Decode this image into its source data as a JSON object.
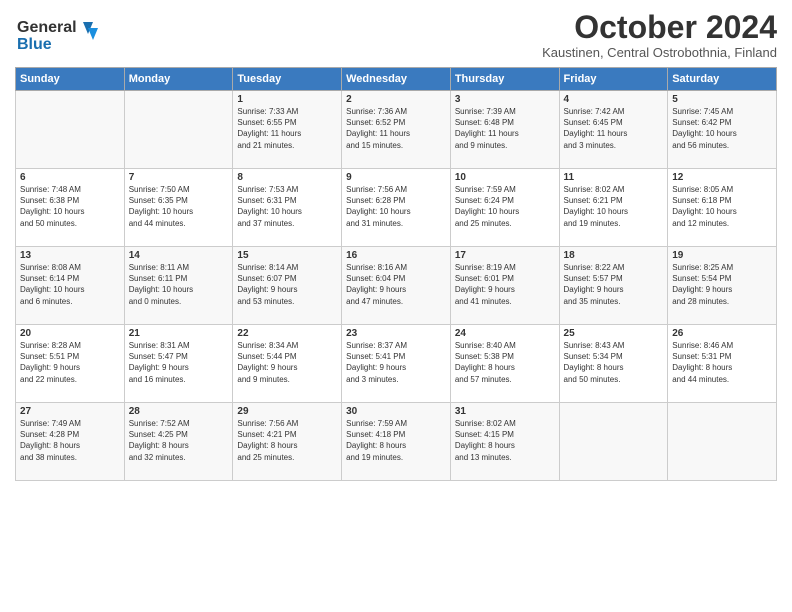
{
  "header": {
    "logo_line1": "General",
    "logo_line2": "Blue",
    "month": "October 2024",
    "location": "Kaustinen, Central Ostrobothnia, Finland"
  },
  "days_of_week": [
    "Sunday",
    "Monday",
    "Tuesday",
    "Wednesday",
    "Thursday",
    "Friday",
    "Saturday"
  ],
  "weeks": [
    [
      {
        "day": "",
        "info": ""
      },
      {
        "day": "",
        "info": ""
      },
      {
        "day": "1",
        "info": "Sunrise: 7:33 AM\nSunset: 6:55 PM\nDaylight: 11 hours\nand 21 minutes."
      },
      {
        "day": "2",
        "info": "Sunrise: 7:36 AM\nSunset: 6:52 PM\nDaylight: 11 hours\nand 15 minutes."
      },
      {
        "day": "3",
        "info": "Sunrise: 7:39 AM\nSunset: 6:48 PM\nDaylight: 11 hours\nand 9 minutes."
      },
      {
        "day": "4",
        "info": "Sunrise: 7:42 AM\nSunset: 6:45 PM\nDaylight: 11 hours\nand 3 minutes."
      },
      {
        "day": "5",
        "info": "Sunrise: 7:45 AM\nSunset: 6:42 PM\nDaylight: 10 hours\nand 56 minutes."
      }
    ],
    [
      {
        "day": "6",
        "info": "Sunrise: 7:48 AM\nSunset: 6:38 PM\nDaylight: 10 hours\nand 50 minutes."
      },
      {
        "day": "7",
        "info": "Sunrise: 7:50 AM\nSunset: 6:35 PM\nDaylight: 10 hours\nand 44 minutes."
      },
      {
        "day": "8",
        "info": "Sunrise: 7:53 AM\nSunset: 6:31 PM\nDaylight: 10 hours\nand 37 minutes."
      },
      {
        "day": "9",
        "info": "Sunrise: 7:56 AM\nSunset: 6:28 PM\nDaylight: 10 hours\nand 31 minutes."
      },
      {
        "day": "10",
        "info": "Sunrise: 7:59 AM\nSunset: 6:24 PM\nDaylight: 10 hours\nand 25 minutes."
      },
      {
        "day": "11",
        "info": "Sunrise: 8:02 AM\nSunset: 6:21 PM\nDaylight: 10 hours\nand 19 minutes."
      },
      {
        "day": "12",
        "info": "Sunrise: 8:05 AM\nSunset: 6:18 PM\nDaylight: 10 hours\nand 12 minutes."
      }
    ],
    [
      {
        "day": "13",
        "info": "Sunrise: 8:08 AM\nSunset: 6:14 PM\nDaylight: 10 hours\nand 6 minutes."
      },
      {
        "day": "14",
        "info": "Sunrise: 8:11 AM\nSunset: 6:11 PM\nDaylight: 10 hours\nand 0 minutes."
      },
      {
        "day": "15",
        "info": "Sunrise: 8:14 AM\nSunset: 6:07 PM\nDaylight: 9 hours\nand 53 minutes."
      },
      {
        "day": "16",
        "info": "Sunrise: 8:16 AM\nSunset: 6:04 PM\nDaylight: 9 hours\nand 47 minutes."
      },
      {
        "day": "17",
        "info": "Sunrise: 8:19 AM\nSunset: 6:01 PM\nDaylight: 9 hours\nand 41 minutes."
      },
      {
        "day": "18",
        "info": "Sunrise: 8:22 AM\nSunset: 5:57 PM\nDaylight: 9 hours\nand 35 minutes."
      },
      {
        "day": "19",
        "info": "Sunrise: 8:25 AM\nSunset: 5:54 PM\nDaylight: 9 hours\nand 28 minutes."
      }
    ],
    [
      {
        "day": "20",
        "info": "Sunrise: 8:28 AM\nSunset: 5:51 PM\nDaylight: 9 hours\nand 22 minutes."
      },
      {
        "day": "21",
        "info": "Sunrise: 8:31 AM\nSunset: 5:47 PM\nDaylight: 9 hours\nand 16 minutes."
      },
      {
        "day": "22",
        "info": "Sunrise: 8:34 AM\nSunset: 5:44 PM\nDaylight: 9 hours\nand 9 minutes."
      },
      {
        "day": "23",
        "info": "Sunrise: 8:37 AM\nSunset: 5:41 PM\nDaylight: 9 hours\nand 3 minutes."
      },
      {
        "day": "24",
        "info": "Sunrise: 8:40 AM\nSunset: 5:38 PM\nDaylight: 8 hours\nand 57 minutes."
      },
      {
        "day": "25",
        "info": "Sunrise: 8:43 AM\nSunset: 5:34 PM\nDaylight: 8 hours\nand 50 minutes."
      },
      {
        "day": "26",
        "info": "Sunrise: 8:46 AM\nSunset: 5:31 PM\nDaylight: 8 hours\nand 44 minutes."
      }
    ],
    [
      {
        "day": "27",
        "info": "Sunrise: 7:49 AM\nSunset: 4:28 PM\nDaylight: 8 hours\nand 38 minutes."
      },
      {
        "day": "28",
        "info": "Sunrise: 7:52 AM\nSunset: 4:25 PM\nDaylight: 8 hours\nand 32 minutes."
      },
      {
        "day": "29",
        "info": "Sunrise: 7:56 AM\nSunset: 4:21 PM\nDaylight: 8 hours\nand 25 minutes."
      },
      {
        "day": "30",
        "info": "Sunrise: 7:59 AM\nSunset: 4:18 PM\nDaylight: 8 hours\nand 19 minutes."
      },
      {
        "day": "31",
        "info": "Sunrise: 8:02 AM\nSunset: 4:15 PM\nDaylight: 8 hours\nand 13 minutes."
      },
      {
        "day": "",
        "info": ""
      },
      {
        "day": "",
        "info": ""
      }
    ]
  ]
}
